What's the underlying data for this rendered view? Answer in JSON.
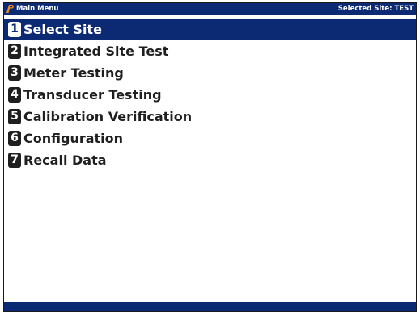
{
  "titlebar": {
    "title": "Main Menu",
    "selected_site": "Selected Site: TEST",
    "logo_icon": "p-logo-icon"
  },
  "menu": {
    "selected_index": 0,
    "items": [
      {
        "number": "1",
        "label": "Select Site"
      },
      {
        "number": "2",
        "label": "Integrated Site Test"
      },
      {
        "number": "3",
        "label": "Meter Testing"
      },
      {
        "number": "4",
        "label": "Transducer Testing"
      },
      {
        "number": "5",
        "label": "Calibration Verification"
      },
      {
        "number": "6",
        "label": "Configuration"
      },
      {
        "number": "7",
        "label": "Recall Data"
      }
    ]
  },
  "colors": {
    "bar_bg": "#0c2a73",
    "logo_orange": "#f28c1e",
    "text": "#1f1f1f",
    "background": "#ffffff"
  }
}
